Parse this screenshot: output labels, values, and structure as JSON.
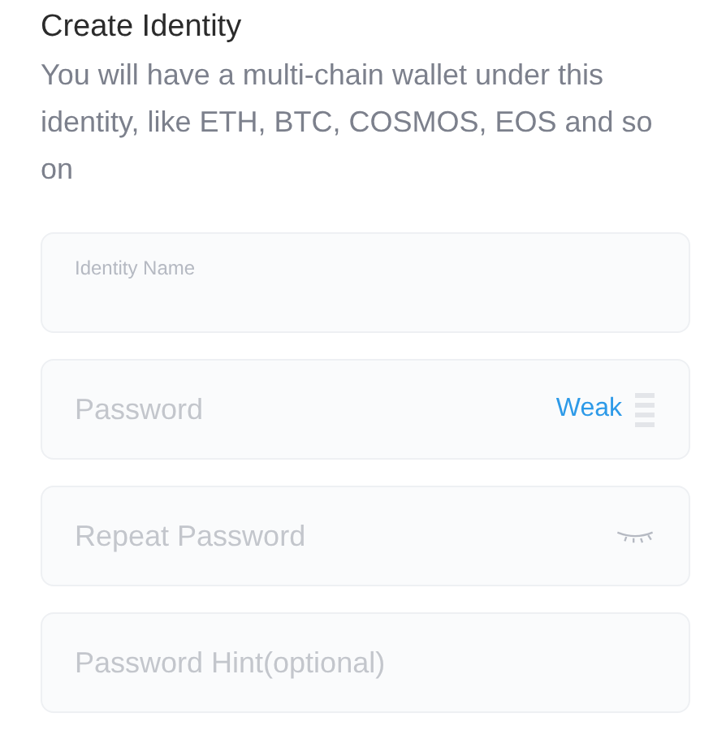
{
  "title": "Create Identity",
  "description": "You will have a multi-chain wallet under this identity, like ETH, BTC, COSMOS, EOS and so on",
  "fields": [
    {
      "kind": "label",
      "label": "Identity Name"
    },
    {
      "kind": "strength",
      "placeholder": "Password",
      "strength_label": "Weak"
    },
    {
      "kind": "eye",
      "placeholder": "Repeat Password"
    },
    {
      "kind": "plain",
      "placeholder": "Password Hint(optional)"
    }
  ]
}
